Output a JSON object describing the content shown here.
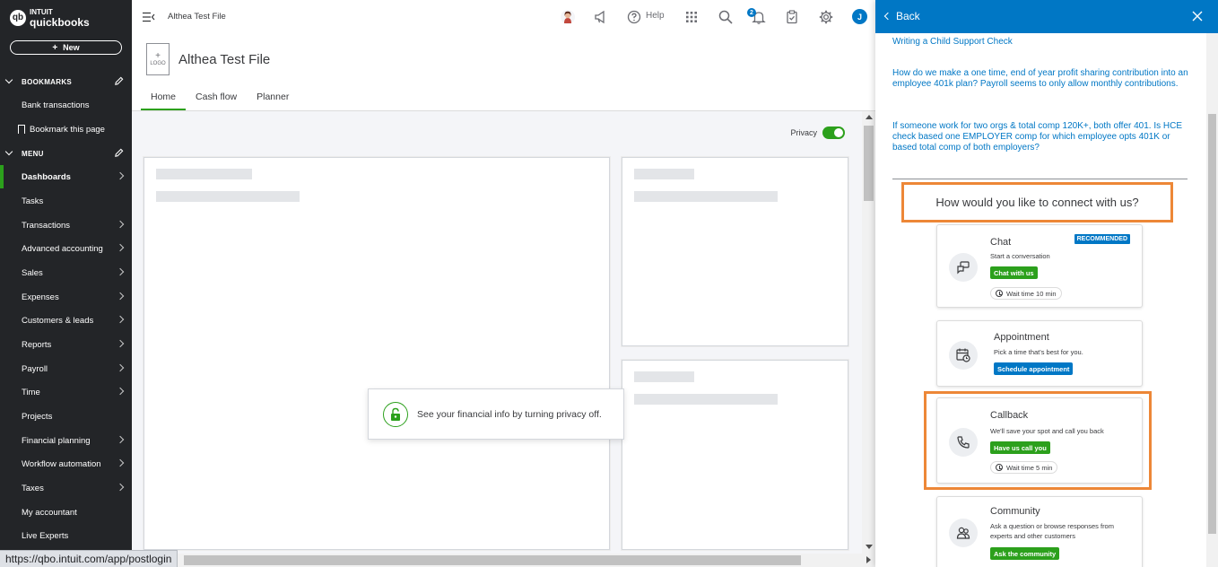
{
  "browser": {
    "status_url": "https://qbo.intuit.com/app/postlogin"
  },
  "brand": {
    "intuit": "INTUIT",
    "name": "quickbooks",
    "mark": "qb"
  },
  "sidebar": {
    "new_label": "New",
    "bookmarks_header": "BOOKMARKS",
    "bookmarks": [
      "Bank transactions",
      "Bookmark this page"
    ],
    "menu_header": "MENU",
    "menu": [
      {
        "label": "Dashboards",
        "arrow": true,
        "active": true
      },
      {
        "label": "Tasks",
        "arrow": false
      },
      {
        "label": "Transactions",
        "arrow": true
      },
      {
        "label": "Advanced accounting",
        "arrow": true
      },
      {
        "label": "Sales",
        "arrow": true
      },
      {
        "label": "Expenses",
        "arrow": true
      },
      {
        "label": "Customers & leads",
        "arrow": true
      },
      {
        "label": "Reports",
        "arrow": true
      },
      {
        "label": "Payroll",
        "arrow": true
      },
      {
        "label": "Time",
        "arrow": true
      },
      {
        "label": "Projects",
        "arrow": false
      },
      {
        "label": "Financial planning",
        "arrow": true
      },
      {
        "label": "Workflow automation",
        "arrow": true
      },
      {
        "label": "Taxes",
        "arrow": true
      },
      {
        "label": "My accountant",
        "arrow": false
      },
      {
        "label": "Live Experts",
        "arrow": false
      }
    ]
  },
  "topbar": {
    "company": "Althea Test File",
    "help_label": "Help",
    "notification_count": "2",
    "user_initial": "J"
  },
  "company_header": {
    "logo_placeholder": "LOGO",
    "title": "Althea Test File",
    "tabs": [
      "Home",
      "Cash flow",
      "Planner"
    ]
  },
  "main": {
    "privacy_label": "Privacy",
    "privacy_on": true,
    "privacy_message": "See your financial info by turning privacy off."
  },
  "panel": {
    "back_label": "Back",
    "links": [
      "Writing a Child Support Check",
      "How do we make a one time, end of year profit sharing contribution into an employee 401k plan? Payroll seems to only allow monthly contributions.",
      "If someone work for two orgs & total comp 120K+, both offer 401. Is HCE check based one EMPLOYER comp for which employee opts 401K or based total comp of both employers?"
    ],
    "connect_title": "How would you like to connect with us?",
    "options": {
      "chat": {
        "title": "Chat",
        "badge": "RECOMMENDED",
        "desc": "Start a conversation",
        "button": "Chat with us",
        "wait": "Wait time 10 min"
      },
      "appointment": {
        "title": "Appointment",
        "desc": "Pick a time that's best for you.",
        "button": "Schedule appointment"
      },
      "callback": {
        "title": "Callback",
        "desc": "We'll save your spot and call you back",
        "button": "Have us call you",
        "wait": "Wait time 5 min"
      },
      "community": {
        "title": "Community",
        "desc": "Ask a question or browse responses from experts and other customers",
        "button": "Ask the community"
      }
    }
  },
  "colors": {
    "brand_green": "#2ca01c",
    "brand_blue": "#0077c5",
    "sidebar_bg": "#232528",
    "highlight_orange": "#ed8737"
  }
}
